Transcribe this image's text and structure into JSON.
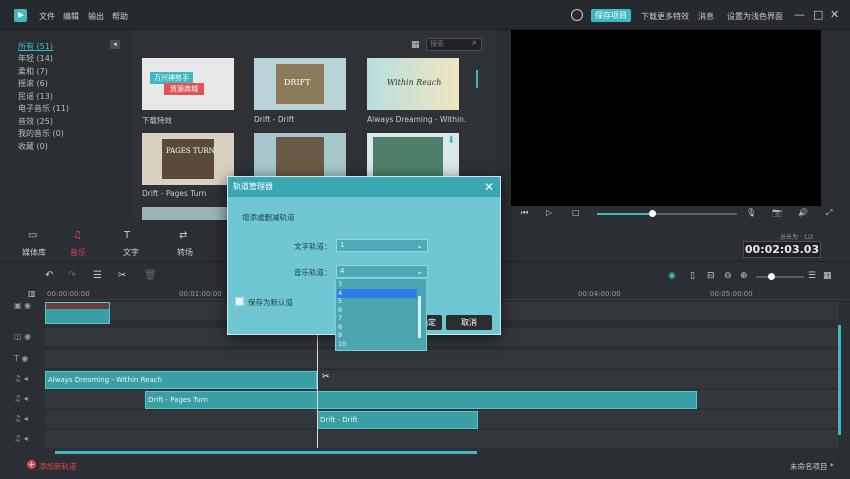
{
  "menu": [
    "文件",
    "编辑",
    "输出",
    "帮助"
  ],
  "titlebar": {
    "save_project": "保存项目",
    "download_more": "下载更多特效",
    "messages": "消息",
    "set_default_ui": "设置为浅色界面",
    "minimize": "—",
    "maximize": "□",
    "close": "✕"
  },
  "library": {
    "items": [
      "所有 (51)",
      "年轻 (14)",
      "柔和 (7)",
      "摇滚 (6)",
      "民谣 (13)",
      "电子音乐 (11)",
      "音效 (25)",
      "我的音乐 (0)",
      "收藏 (0)"
    ]
  },
  "media": {
    "search_placeholder": "搜索",
    "thumbs": [
      {
        "label": "下载特效",
        "art1": "万兴神剪手",
        "art2": "资源商城"
      },
      {
        "label": "Drift - Drift",
        "art1": "DRIFT"
      },
      {
        "label": "Always Dreaming - Within...",
        "art1": "Within Reach"
      },
      {
        "label": "Drift - Pages Turn",
        "art1": "PAGES TURN"
      },
      {
        "label": "",
        "art1": ""
      },
      {
        "label": "",
        "art1": ""
      }
    ]
  },
  "tools": [
    "媒体库",
    "音乐",
    "文字",
    "转场"
  ],
  "timecode": {
    "label": "总长为 · 1/2",
    "value": "00:02:03.03"
  },
  "ruler": [
    "00:00:00:00",
    "00:01:00:00",
    "00:04:00:00",
    "00:05:00:00"
  ],
  "clips": {
    "always": "Always Dreaming - Within Reach",
    "pages": "Drift - Pages Turn",
    "drift": "Drift - Drift"
  },
  "footer": {
    "add_track": "添加新轨道",
    "project": "未命名项目 *"
  },
  "dialog": {
    "title": "轨道管理器",
    "heading": "增添或删减轨道",
    "text_track_label": "文字轨道：",
    "text_track_value": "1",
    "music_track_label": "音乐轨道：",
    "music_track_value": "4",
    "save_default": "保存为默认值",
    "ok": "确定",
    "cancel": "取消",
    "options": [
      "3",
      "4",
      "5",
      "6",
      "7",
      "8",
      "9",
      "10"
    ],
    "selected_option": "4"
  },
  "colors": {
    "accent": "#3fb8c4",
    "danger": "#d94b4b"
  }
}
